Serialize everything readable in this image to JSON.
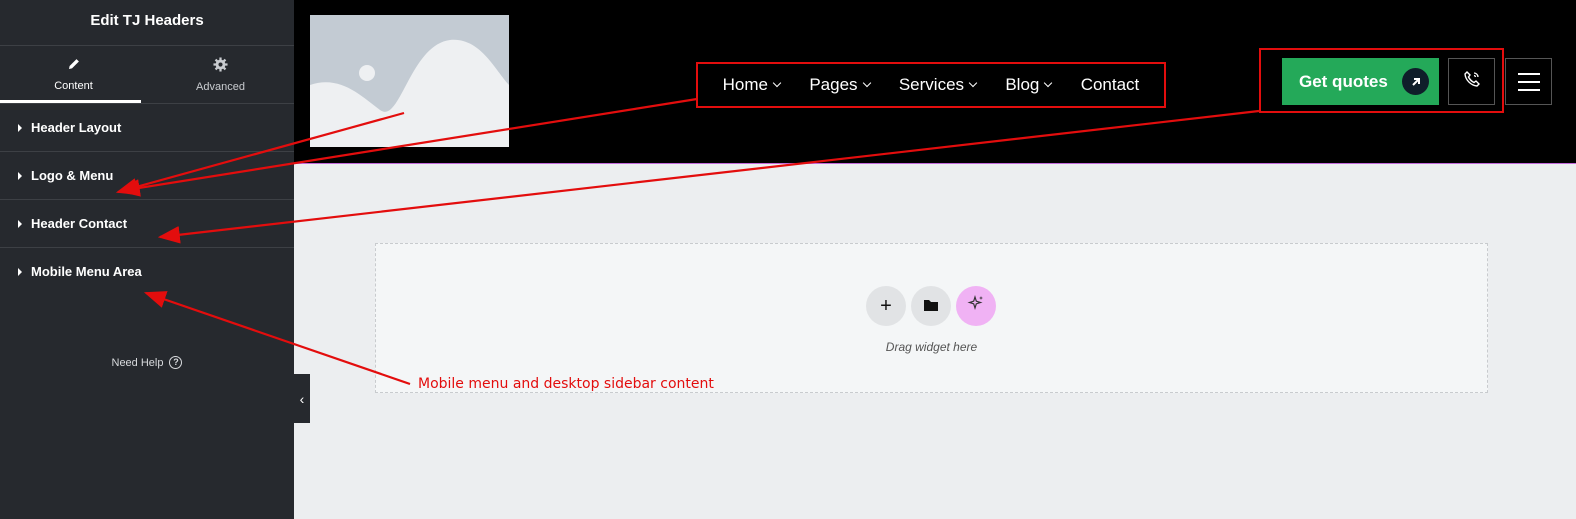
{
  "panel": {
    "title": "Edit TJ Headers",
    "tabs": [
      {
        "label": "Content",
        "icon": "pencil-icon"
      },
      {
        "label": "Advanced",
        "icon": "gear-icon"
      }
    ],
    "sections": [
      {
        "label": "Header Layout"
      },
      {
        "label": "Logo & Menu"
      },
      {
        "label": "Header Contact"
      },
      {
        "label": "Mobile Menu Area"
      }
    ],
    "help_label": "Need Help",
    "help_icon": "question-circle-icon"
  },
  "header": {
    "nav": [
      {
        "label": "Home",
        "has_dropdown": true
      },
      {
        "label": "Pages",
        "has_dropdown": true
      },
      {
        "label": "Services",
        "has_dropdown": true
      },
      {
        "label": "Blog",
        "has_dropdown": true
      },
      {
        "label": "Contact",
        "has_dropdown": false
      }
    ],
    "cta_label": "Get quotes",
    "cta_color": "#24a959",
    "phone_icon": "phone-icon",
    "menu_icon": "hamburger-icon"
  },
  "canvas": {
    "drop_text": "Drag widget here",
    "annotation": "Mobile menu and desktop sidebar content",
    "annotation_color": "#e30d0d"
  }
}
